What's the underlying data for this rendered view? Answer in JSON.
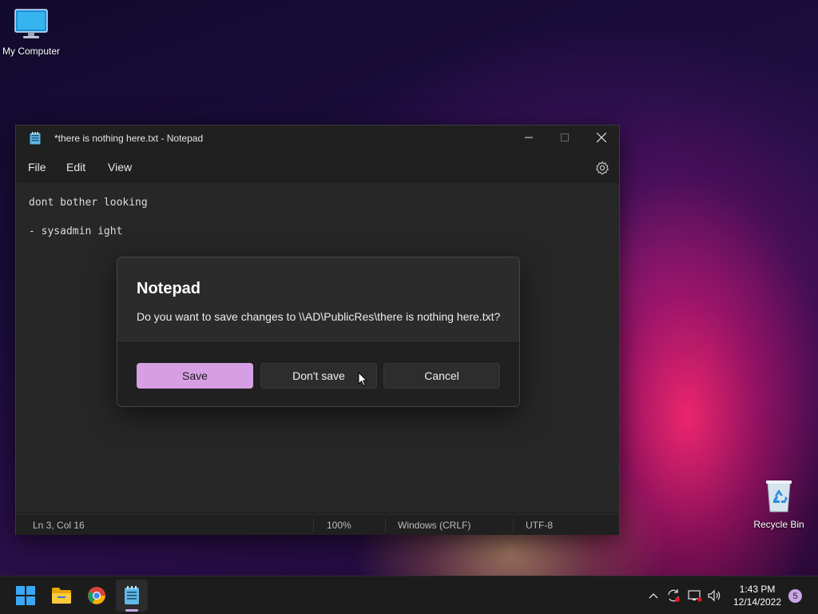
{
  "desktop": {
    "icons": [
      {
        "label": "My Computer",
        "icon": "monitor-icon"
      },
      {
        "label": "Recycle Bin",
        "icon": "recycle-bin-icon"
      }
    ]
  },
  "notepad": {
    "title": "*there is nothing here.txt - Notepad",
    "menu": {
      "file": "File",
      "edit": "Edit",
      "view": "View"
    },
    "content": {
      "line1": "dont bother looking",
      "line3": "- sysadmin ight"
    },
    "status": {
      "position": "Ln 3, Col 16",
      "zoom": "100%",
      "line_endings": "Windows (CRLF)",
      "encoding": "UTF-8"
    }
  },
  "dialog": {
    "title": "Notepad",
    "message": "Do you want to save changes to \\\\AD\\PublicRes\\there is nothing here.txt?",
    "buttons": {
      "save": "Save",
      "dont_save": "Don't save",
      "cancel": "Cancel"
    },
    "accent_color": "#d79fe3"
  },
  "taskbar": {
    "apps": [
      "start-icon",
      "file-explorer-icon",
      "chrome-icon",
      "notepad-icon"
    ],
    "clock": {
      "time": "1:43 PM",
      "date": "12/14/2022"
    },
    "notification_count": "5"
  }
}
